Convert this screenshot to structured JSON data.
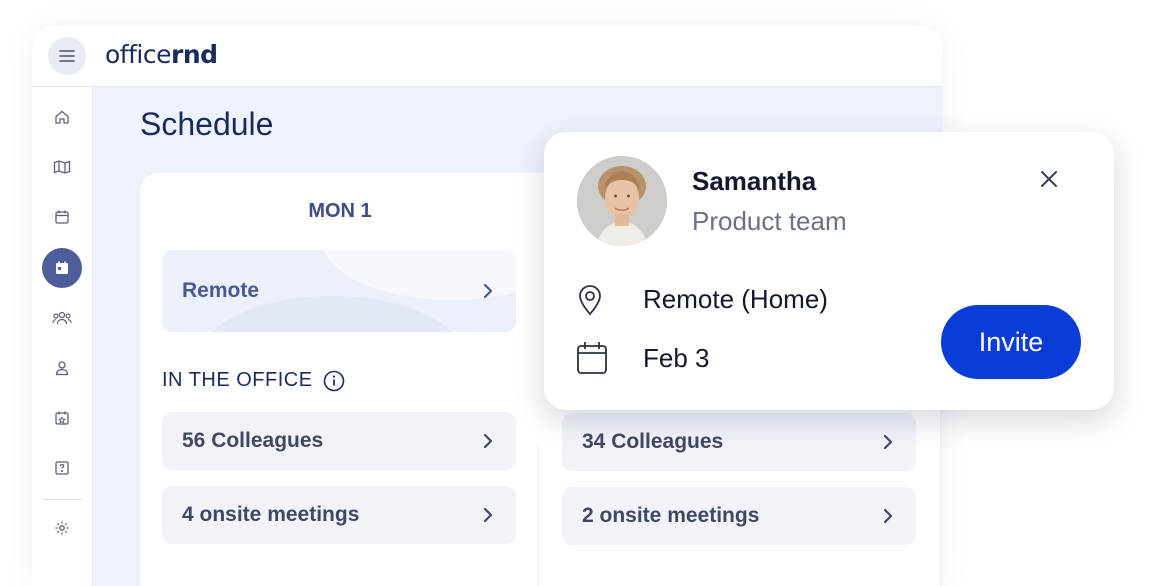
{
  "app": {
    "logo_light": "office",
    "logo_bold": "rnd"
  },
  "sidebar": {
    "items": [
      {
        "icon": "home-icon"
      },
      {
        "icon": "map-icon"
      },
      {
        "icon": "calendar-icon"
      },
      {
        "icon": "schedule-icon",
        "active": true
      },
      {
        "icon": "team-icon"
      },
      {
        "icon": "user-icon"
      },
      {
        "icon": "booking-icon"
      },
      {
        "icon": "help-icon"
      },
      {
        "icon": "settings-icon"
      }
    ]
  },
  "page": {
    "title": "Schedule"
  },
  "schedule": {
    "day_label": "MON 1",
    "remote_label": "Remote",
    "section_label": "IN THE OFFICE",
    "col1": {
      "colleagues": "56 Colleagues",
      "meetings": "4 onsite meetings"
    },
    "col2": {
      "colleagues": "34 Colleagues",
      "meetings": "2 onsite meetings"
    }
  },
  "popup": {
    "name": "Samantha",
    "team": "Product team",
    "location": "Remote (Home)",
    "date": "Feb 3",
    "invite_label": "Invite"
  },
  "colors": {
    "accent": "#0a3cd8",
    "nav_active": "#4d5d9a",
    "brand": "#1a2a5c"
  }
}
